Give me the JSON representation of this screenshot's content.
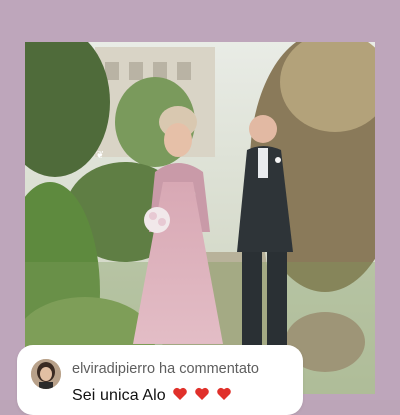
{
  "story": {
    "photo_description_icon": "wedding-photo",
    "watermark": {
      "symbol": "❦",
      "text": ""
    }
  },
  "comment": {
    "username": "elviradipierro",
    "action": "ha commentato",
    "text": "Sei unica Alo",
    "emoji": [
      "heart",
      "heart",
      "heart"
    ],
    "heart_color": "#e0302a"
  },
  "colors": {
    "background": "#bea6bb",
    "card": "#ffffff"
  }
}
